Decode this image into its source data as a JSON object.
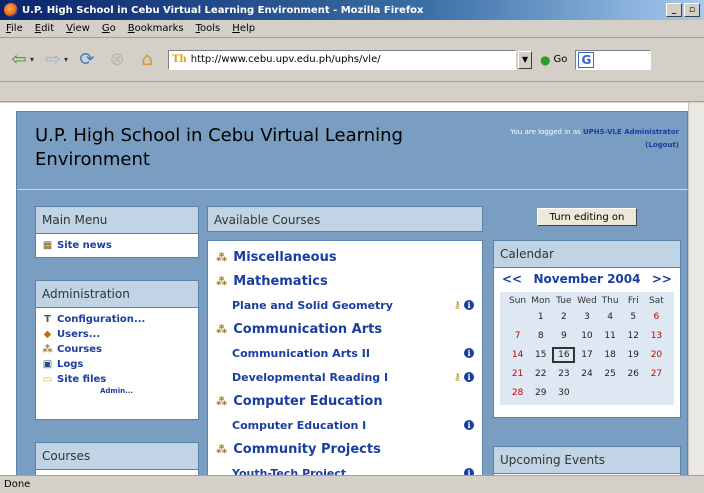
{
  "window": {
    "title": "U.P. High School in Cebu Virtual Learning Environment - Mozilla Firefox"
  },
  "menubar": [
    "File",
    "Edit",
    "View",
    "Go",
    "Bookmarks",
    "Tools",
    "Help"
  ],
  "toolbar": {
    "url": "http://www.cebu.upv.edu.ph/uphs/vle/",
    "go_label": "Go",
    "site_icon": "Th"
  },
  "page": {
    "site_title": "U.P. High School in Cebu Virtual Learning Environment",
    "login_prefix": "You are logged in as",
    "login_user": "UPHS-VLE Administrator",
    "logout": "(Logout)"
  },
  "main_menu": {
    "title": "Main Menu",
    "items": [
      {
        "label": "Site news",
        "icon": "news-icon"
      }
    ]
  },
  "administration": {
    "title": "Administration",
    "items": [
      {
        "label": "Configuration...",
        "icon": "hammer-icon"
      },
      {
        "label": "Users...",
        "icon": "users-icon"
      },
      {
        "label": "Courses",
        "icon": "course-icon"
      },
      {
        "label": "Logs",
        "icon": "logs-icon"
      },
      {
        "label": "Site files",
        "icon": "folder-icon"
      }
    ],
    "more": "Admin..."
  },
  "courses_block": {
    "title": "Courses"
  },
  "available_courses": {
    "title": "Available Courses",
    "entries": [
      {
        "type": "category",
        "label": "Miscellaneous"
      },
      {
        "type": "category",
        "label": "Mathematics"
      },
      {
        "type": "course",
        "label": "Plane and Solid Geometry",
        "key": true,
        "info": true
      },
      {
        "type": "category",
        "label": "Communication Arts"
      },
      {
        "type": "course",
        "label": "Communication Arts II",
        "key": false,
        "info": true
      },
      {
        "type": "course",
        "label": "Developmental Reading I",
        "key": true,
        "info": true
      },
      {
        "type": "category",
        "label": "Computer Education"
      },
      {
        "type": "course",
        "label": "Computer Education I",
        "key": false,
        "info": true
      },
      {
        "type": "category",
        "label": "Community Projects"
      },
      {
        "type": "course",
        "label": "Youth-Tech Project",
        "key": false,
        "info": true
      }
    ]
  },
  "turn_editing_label": "Turn editing on",
  "calendar": {
    "title": "Calendar",
    "prev": "<<",
    "next": ">>",
    "month": "November 2004",
    "weekdays": [
      "Sun",
      "Mon",
      "Tue",
      "Wed",
      "Thu",
      "Fri",
      "Sat"
    ],
    "weeks": [
      [
        "",
        "1",
        "2",
        "3",
        "4",
        "5",
        "6"
      ],
      [
        "7",
        "8",
        "9",
        "10",
        "11",
        "12",
        "13"
      ],
      [
        "14",
        "15",
        "16",
        "17",
        "18",
        "19",
        "20"
      ],
      [
        "21",
        "22",
        "23",
        "24",
        "25",
        "26",
        "27"
      ],
      [
        "28",
        "29",
        "30",
        "",
        "",
        "",
        ""
      ]
    ],
    "today": "16"
  },
  "upcoming_events": {
    "title": "Upcoming Events"
  },
  "status": "Done"
}
